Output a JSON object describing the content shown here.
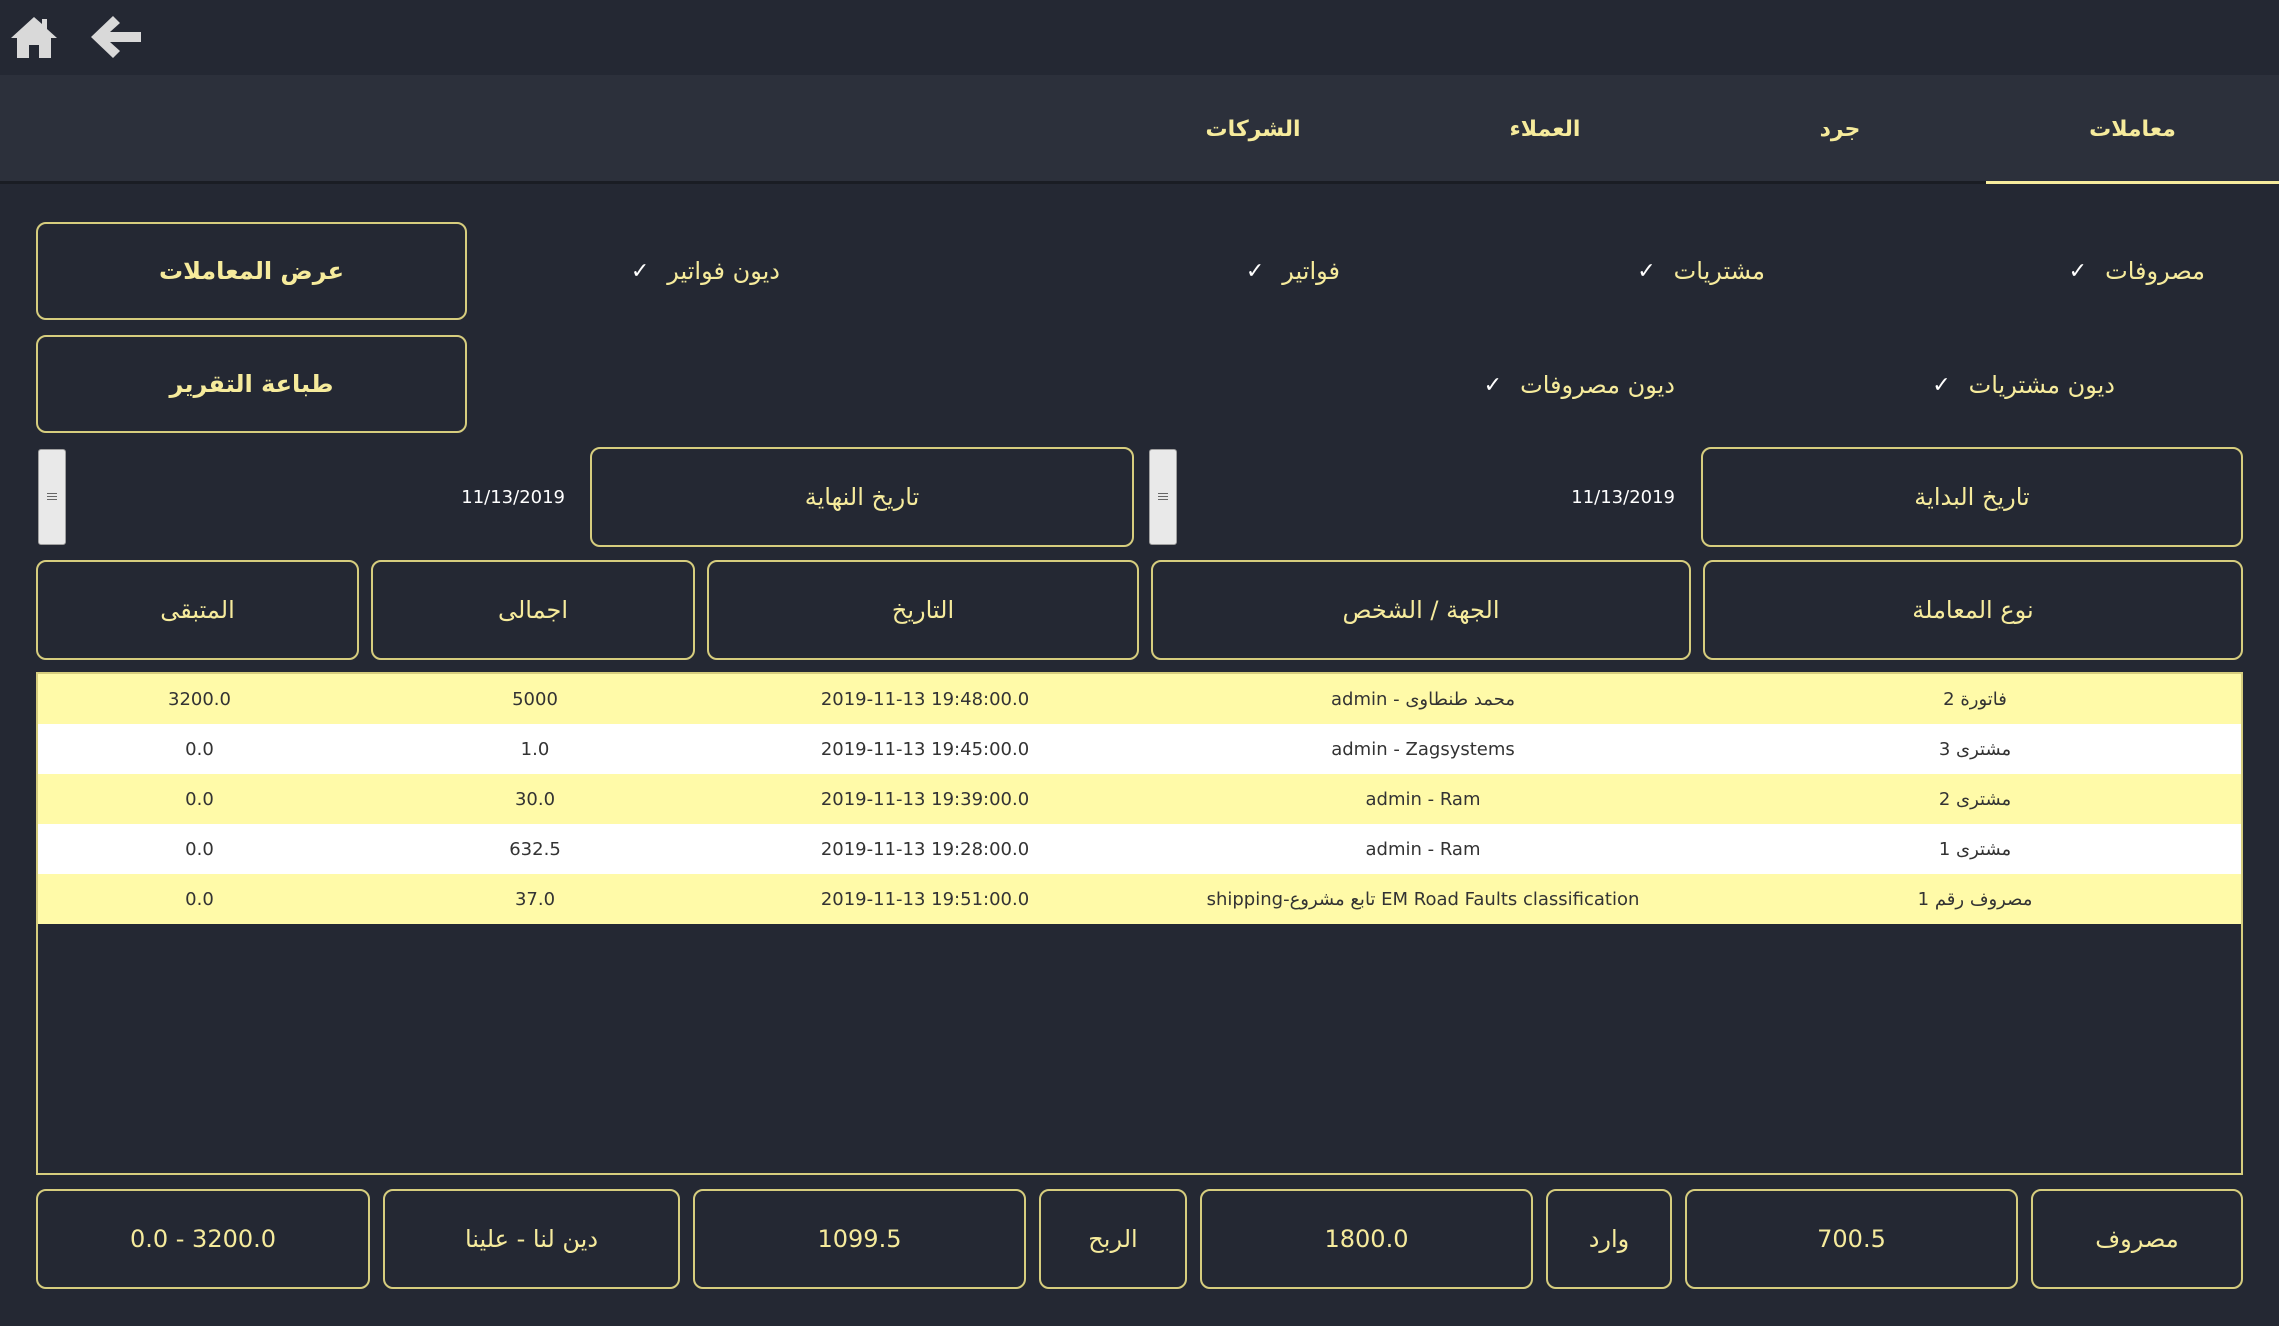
{
  "toolbar": {
    "home_icon": "home-icon",
    "back_icon": "back-arrow-icon"
  },
  "tabs": [
    {
      "label": "معاملات",
      "active": true
    },
    {
      "label": "جرد",
      "active": false
    },
    {
      "label": "العملاء",
      "active": false
    },
    {
      "label": "الشركات",
      "active": false
    }
  ],
  "filters": {
    "expenses": "مصروفات",
    "purchases": "مشتريات",
    "invoices": "فواتير",
    "invoice_debts": "ديون فواتير",
    "purchase_debts": "ديون مشتريات",
    "expense_debts": "ديون مصروفات",
    "check_mark": "✓"
  },
  "actions": {
    "show_transactions": "عرض المعاملات",
    "print_report": "طباعة التقرير"
  },
  "dates": {
    "start_label": "تاريخ البداية",
    "start_value": "11/13/2019",
    "end_label": "تاريخ النهاية",
    "end_value": "11/13/2019"
  },
  "table": {
    "headers": {
      "type": "نوع المعاملة",
      "party": "الجهة / الشخص",
      "date": "التاريخ",
      "total": "اجمالى",
      "remaining": "المتبقى"
    },
    "rows": [
      {
        "type": "فاتورة 2",
        "party": "admin - محمد طنطاوى",
        "date": "2019-11-13 19:48:00.0",
        "total": "5000",
        "remaining": "3200.0"
      },
      {
        "type": "مشترى 3",
        "party": "admin - Zagsystems",
        "date": "2019-11-13 19:45:00.0",
        "total": "1.0",
        "remaining": "0.0"
      },
      {
        "type": "مشترى 2",
        "party": "admin - Ram",
        "date": "2019-11-13 19:39:00.0",
        "total": "30.0",
        "remaining": "0.0"
      },
      {
        "type": "مشترى 1",
        "party": "admin - Ram",
        "date": "2019-11-13 19:28:00.0",
        "total": "632.5",
        "remaining": "0.0"
      },
      {
        "type": "مصروف رقم 1",
        "party": "shipping-تابع مشروع EM Road Faults classification",
        "date": "2019-11-13 19:51:00.0",
        "total": "37.0",
        "remaining": "0.0"
      }
    ]
  },
  "summary": {
    "expense_label": "مصروف",
    "expense_value": "700.5",
    "income_label": "وارد",
    "income_value": "1800.0",
    "profit_label": "الربح",
    "profit_value": "1099.5",
    "debt_label": "دين لنا - علينا",
    "debt_value": "0.0 - 3200.0"
  },
  "colors": {
    "background": "#242833",
    "accent": "#f6eb9c",
    "row_highlight": "#fffaa8"
  }
}
